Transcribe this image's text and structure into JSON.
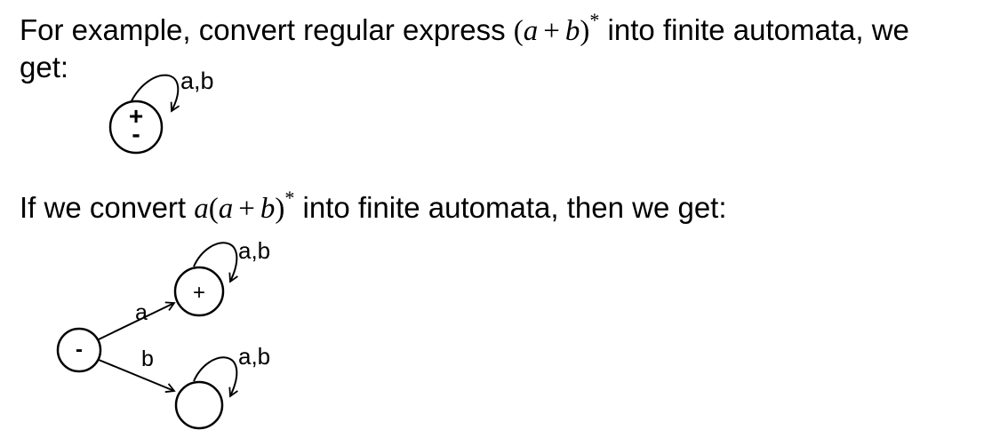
{
  "example1": {
    "text_before": "For example, convert regular express ",
    "expr": {
      "open": "(",
      "a": "a",
      "plus": "+",
      "b": "b",
      "close": ")",
      "star": "*"
    },
    "text_after": " into finite automata, we",
    "continuation": "get:"
  },
  "example2": {
    "text_before": "If we convert ",
    "expr": {
      "prefix": "a",
      "open": "(",
      "a": "a",
      "plus": "+",
      "b": "b",
      "close": ")",
      "star": "*"
    },
    "text_after": " into finite automata, then we get:"
  },
  "diagram1": {
    "state_marks": {
      "start": "+",
      "final": "-"
    },
    "loop_label": "a,b"
  },
  "diagram2": {
    "start_mark": "-",
    "upper_mark": "+",
    "lower_mark": "",
    "edge_a_label": "a",
    "edge_b_label": "b",
    "upper_loop_label": "a,b",
    "lower_loop_label": "a,b"
  }
}
